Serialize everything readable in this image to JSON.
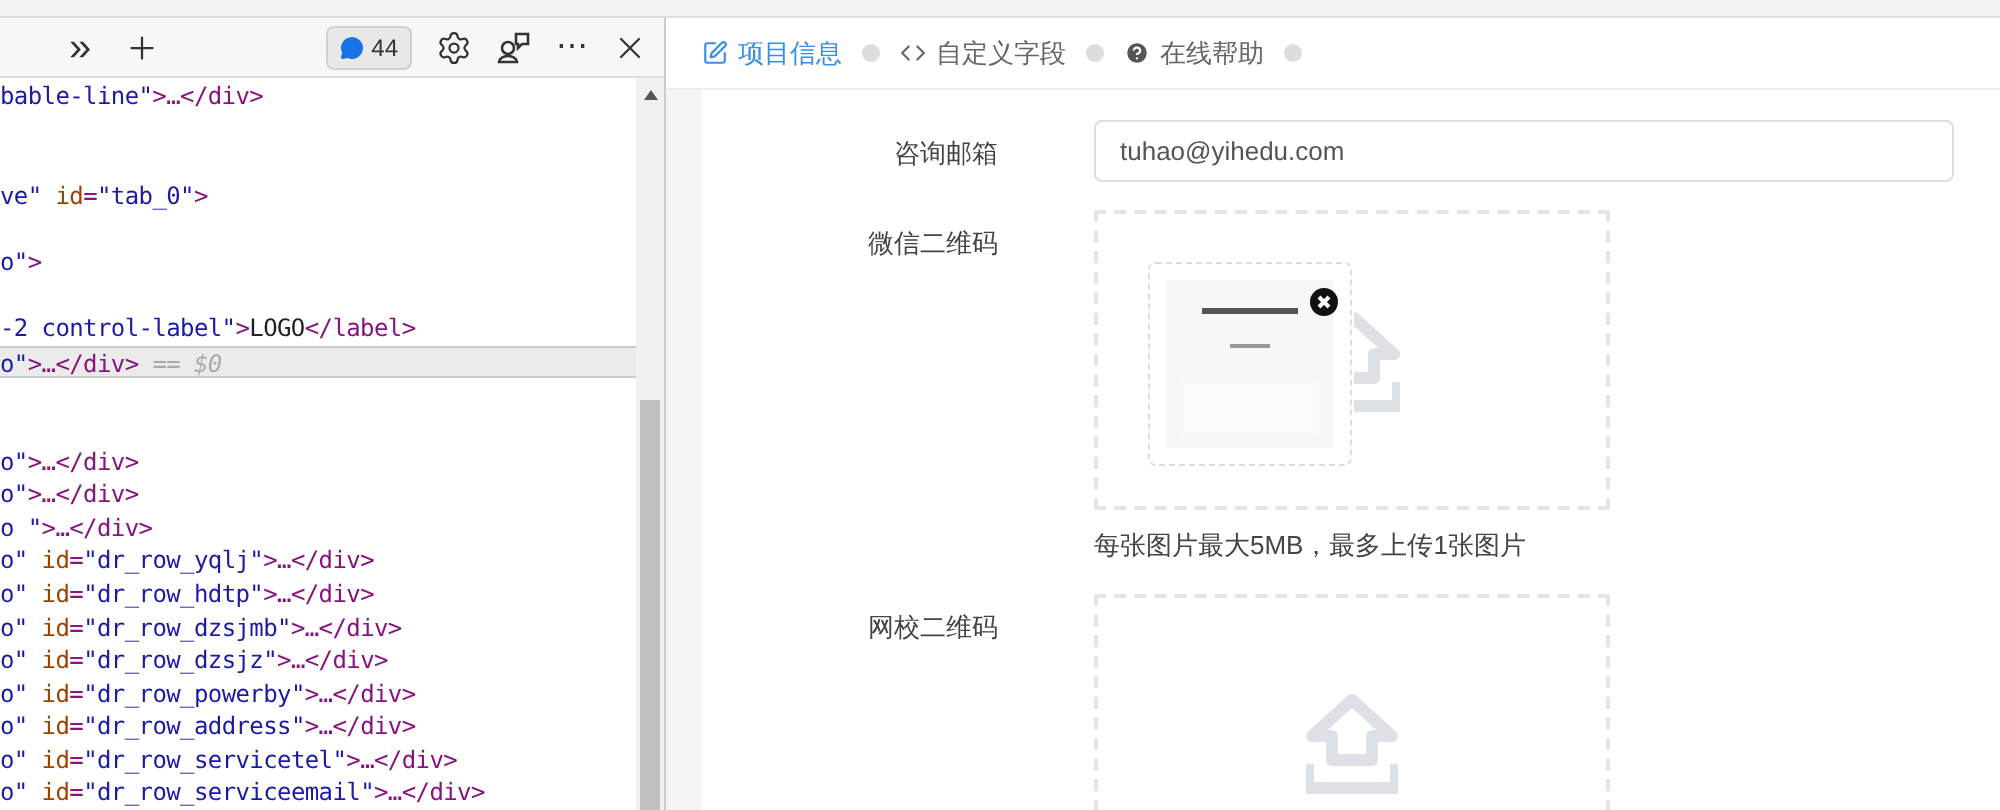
{
  "devtools": {
    "toolbar": {
      "more_tabs": "»",
      "issues_count": "44",
      "more": "⋯"
    },
    "lines": [
      {
        "kind": "code",
        "selected": false,
        "segments": [
          {
            "kind": "value",
            "text": "bable-line\""
          },
          {
            "kind": "tag",
            "text": ">…</div>"
          }
        ]
      },
      {
        "kind": "blank",
        "selected": false
      },
      {
        "kind": "blank",
        "selected": false
      },
      {
        "kind": "code",
        "selected": false,
        "segments": [
          {
            "kind": "value",
            "text": "ve\" "
          },
          {
            "kind": "attr",
            "text": "id"
          },
          {
            "kind": "tag",
            "text": "="
          },
          {
            "kind": "value",
            "text": "\"tab_0\""
          },
          {
            "kind": "tag",
            "text": ">"
          }
        ]
      },
      {
        "kind": "blank",
        "selected": false
      },
      {
        "kind": "code",
        "selected": false,
        "segments": [
          {
            "kind": "value",
            "text": "o\""
          },
          {
            "kind": "tag",
            "text": ">"
          }
        ]
      },
      {
        "kind": "blank",
        "selected": false
      },
      {
        "kind": "code",
        "selected": false,
        "segments": [
          {
            "kind": "value",
            "text": "-2 control-label\""
          },
          {
            "kind": "tag",
            "text": ">"
          },
          {
            "kind": "text",
            "text": "LOGO"
          },
          {
            "kind": "tag",
            "text": "</label>"
          }
        ]
      },
      {
        "kind": "code",
        "selected": true,
        "segments": [
          {
            "kind": "value",
            "text": "o\""
          },
          {
            "kind": "tag",
            "text": ">…</div>"
          },
          {
            "kind": "dim",
            "text": " == $0"
          }
        ]
      },
      {
        "kind": "blank",
        "selected": false
      },
      {
        "kind": "blank",
        "selected": false
      },
      {
        "kind": "code",
        "selected": false,
        "segments": [
          {
            "kind": "value",
            "text": "o\""
          },
          {
            "kind": "tag",
            "text": ">…</div>"
          }
        ]
      },
      {
        "kind": "code",
        "selected": false,
        "segments": [
          {
            "kind": "value",
            "text": "o\""
          },
          {
            "kind": "tag",
            "text": ">…</div>"
          }
        ]
      },
      {
        "kind": "code",
        "selected": false,
        "segments": [
          {
            "kind": "value",
            "text": "o \""
          },
          {
            "kind": "tag",
            "text": ">…</div>"
          }
        ]
      },
      {
        "kind": "code",
        "selected": false,
        "segments": [
          {
            "kind": "value",
            "text": "o\" "
          },
          {
            "kind": "attr",
            "text": "id"
          },
          {
            "kind": "tag",
            "text": "="
          },
          {
            "kind": "value",
            "text": "\"dr_row_yqlj\""
          },
          {
            "kind": "tag",
            "text": ">…</div>"
          }
        ]
      },
      {
        "kind": "code",
        "selected": false,
        "segments": [
          {
            "kind": "value",
            "text": "o\" "
          },
          {
            "kind": "attr",
            "text": "id"
          },
          {
            "kind": "tag",
            "text": "="
          },
          {
            "kind": "value",
            "text": "\"dr_row_hdtp\""
          },
          {
            "kind": "tag",
            "text": ">…</div>"
          }
        ]
      },
      {
        "kind": "code",
        "selected": false,
        "segments": [
          {
            "kind": "value",
            "text": "o\" "
          },
          {
            "kind": "attr",
            "text": "id"
          },
          {
            "kind": "tag",
            "text": "="
          },
          {
            "kind": "value",
            "text": "\"dr_row_dzsjmb\""
          },
          {
            "kind": "tag",
            "text": ">…</div>"
          }
        ]
      },
      {
        "kind": "code",
        "selected": false,
        "segments": [
          {
            "kind": "value",
            "text": "o\" "
          },
          {
            "kind": "attr",
            "text": "id"
          },
          {
            "kind": "tag",
            "text": "="
          },
          {
            "kind": "value",
            "text": "\"dr_row_dzsjz\""
          },
          {
            "kind": "tag",
            "text": ">…</div>"
          }
        ]
      },
      {
        "kind": "code",
        "selected": false,
        "segments": [
          {
            "kind": "value",
            "text": "o\" "
          },
          {
            "kind": "attr",
            "text": "id"
          },
          {
            "kind": "tag",
            "text": "="
          },
          {
            "kind": "value",
            "text": "\"dr_row_powerby\""
          },
          {
            "kind": "tag",
            "text": ">…</div>"
          }
        ]
      },
      {
        "kind": "code",
        "selected": false,
        "segments": [
          {
            "kind": "value",
            "text": "o\" "
          },
          {
            "kind": "attr",
            "text": "id"
          },
          {
            "kind": "tag",
            "text": "="
          },
          {
            "kind": "value",
            "text": "\"dr_row_address\""
          },
          {
            "kind": "tag",
            "text": ">…</div>"
          }
        ]
      },
      {
        "kind": "code",
        "selected": false,
        "segments": [
          {
            "kind": "value",
            "text": "o\" "
          },
          {
            "kind": "attr",
            "text": "id"
          },
          {
            "kind": "tag",
            "text": "="
          },
          {
            "kind": "value",
            "text": "\"dr_row_servicetel\""
          },
          {
            "kind": "tag",
            "text": ">…</div>"
          }
        ]
      },
      {
        "kind": "code",
        "selected": false,
        "segments": [
          {
            "kind": "value",
            "text": "o\" "
          },
          {
            "kind": "attr",
            "text": "id"
          },
          {
            "kind": "tag",
            "text": "="
          },
          {
            "kind": "value",
            "text": "\"dr_row_serviceemail\""
          },
          {
            "kind": "tag",
            "text": ">…</div>"
          }
        ]
      }
    ]
  },
  "tabs": [
    {
      "label": "项目信息",
      "selected": true
    },
    {
      "label": "自定义字段",
      "selected": false
    },
    {
      "label": "在线帮助",
      "selected": false
    }
  ],
  "form": [
    {
      "kind": "text",
      "label": "咨询邮箱",
      "value": "tuhao@yihedu.com"
    },
    {
      "kind": "upload",
      "label": "微信二维码",
      "has_image": true,
      "hint": "每张图片最大5MB，最多上传1张图片"
    },
    {
      "kind": "upload",
      "label": "网校二维码",
      "has_image": false
    }
  ]
}
